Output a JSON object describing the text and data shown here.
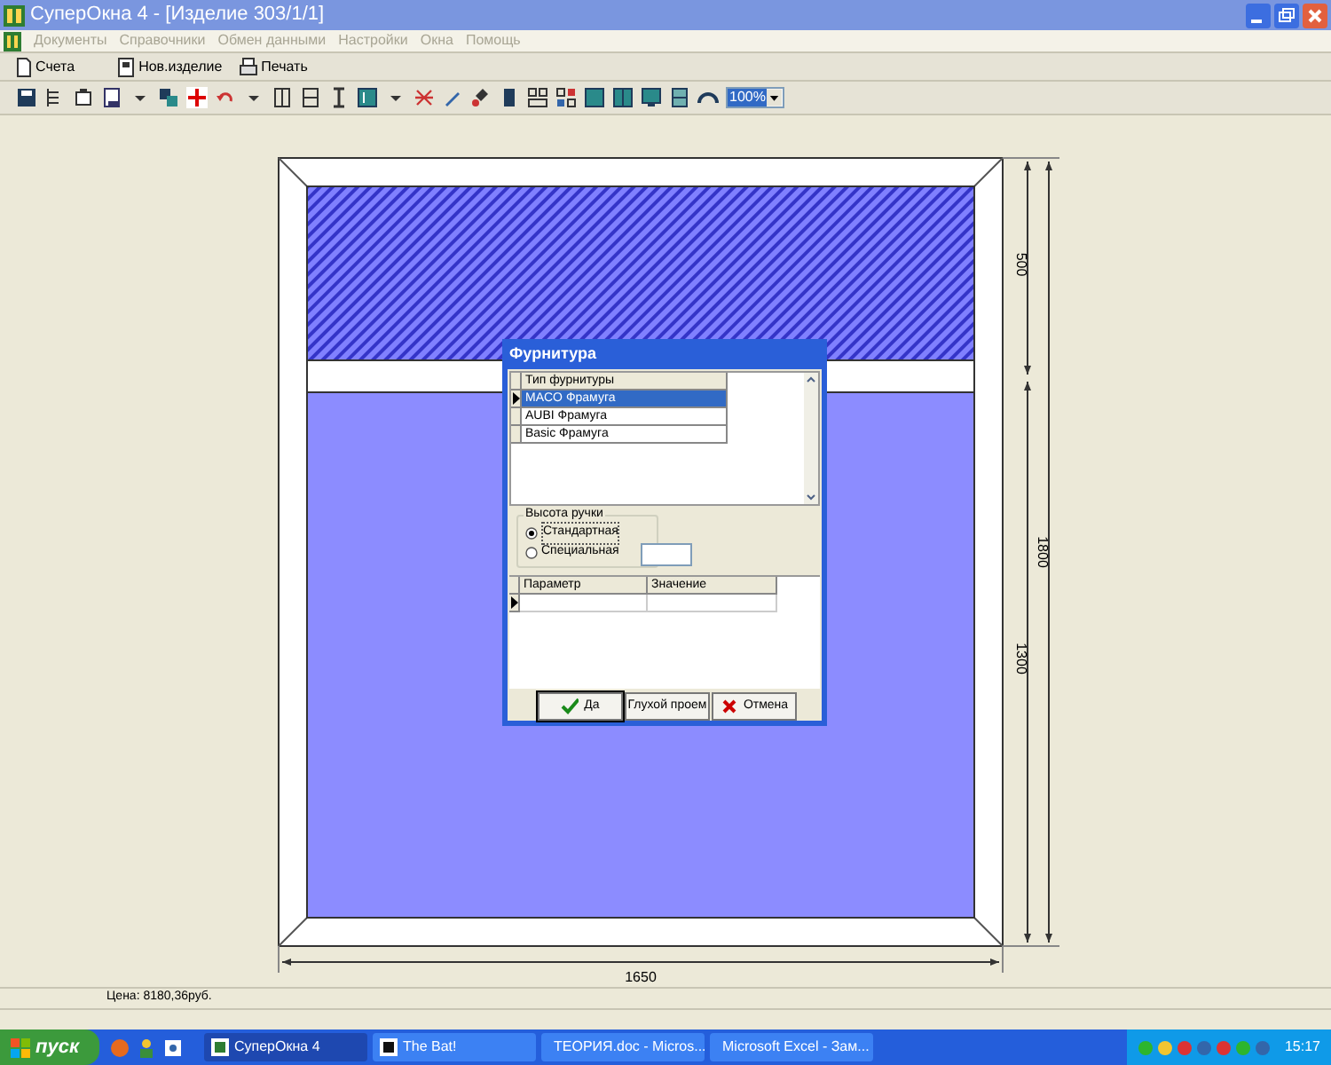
{
  "window": {
    "title": "СуперОкна 4 - [Изделие 303/1/1]"
  },
  "menu": [
    "Документы",
    "Справочники",
    "Обмен данными",
    "Настройки",
    "Окна",
    "Помощь"
  ],
  "toolbar": [
    {
      "label": "Счета",
      "kind": "doc"
    },
    {
      "label": "Нов.изделие",
      "kind": "frame"
    },
    {
      "label": "Печать",
      "kind": "print"
    }
  ],
  "zoom_combo": {
    "value": "100%"
  },
  "drawing": {
    "width_label": "1650",
    "height_label": "1800",
    "top_label": "500",
    "bottom_label": "1300"
  },
  "dialog": {
    "title": "Фурнитура",
    "hardware_table": {
      "columns": [
        "Тип фурнитуры"
      ],
      "rows": [
        {
          "cells": [
            "MACO Фрамуга"
          ],
          "selected": true
        },
        {
          "cells": [
            "AUBI Фрамуга"
          ],
          "selected": false
        },
        {
          "cells": [
            "Basic Фрамуга"
          ],
          "selected": false
        }
      ]
    },
    "handle_height": {
      "legend": "Высота ручки",
      "options": [
        {
          "label": "Стандартная",
          "selected": true
        },
        {
          "label": "Специальная",
          "selected": false
        }
      ]
    },
    "param_table": {
      "columns": [
        "Параметр",
        "Значение"
      ]
    },
    "buttons": [
      {
        "label": "Да",
        "kind": "ok"
      },
      {
        "label": "Глухой проем",
        "kind": "plain"
      },
      {
        "label": "Отмена",
        "kind": "cancel"
      }
    ]
  },
  "status_bar": {
    "price": "Цена: 8180,36руб."
  },
  "taskbar": {
    "start": "пуск",
    "tasks": [
      {
        "label": "СуперОкна 4",
        "selected": true
      },
      {
        "label": "The Bat!",
        "selected": false
      },
      {
        "label": "ТЕОРИЯ.doc - Micros...",
        "selected": false
      },
      {
        "label": "Microsoft Excel - Зам...",
        "selected": false
      }
    ],
    "clock": "15:17"
  }
}
